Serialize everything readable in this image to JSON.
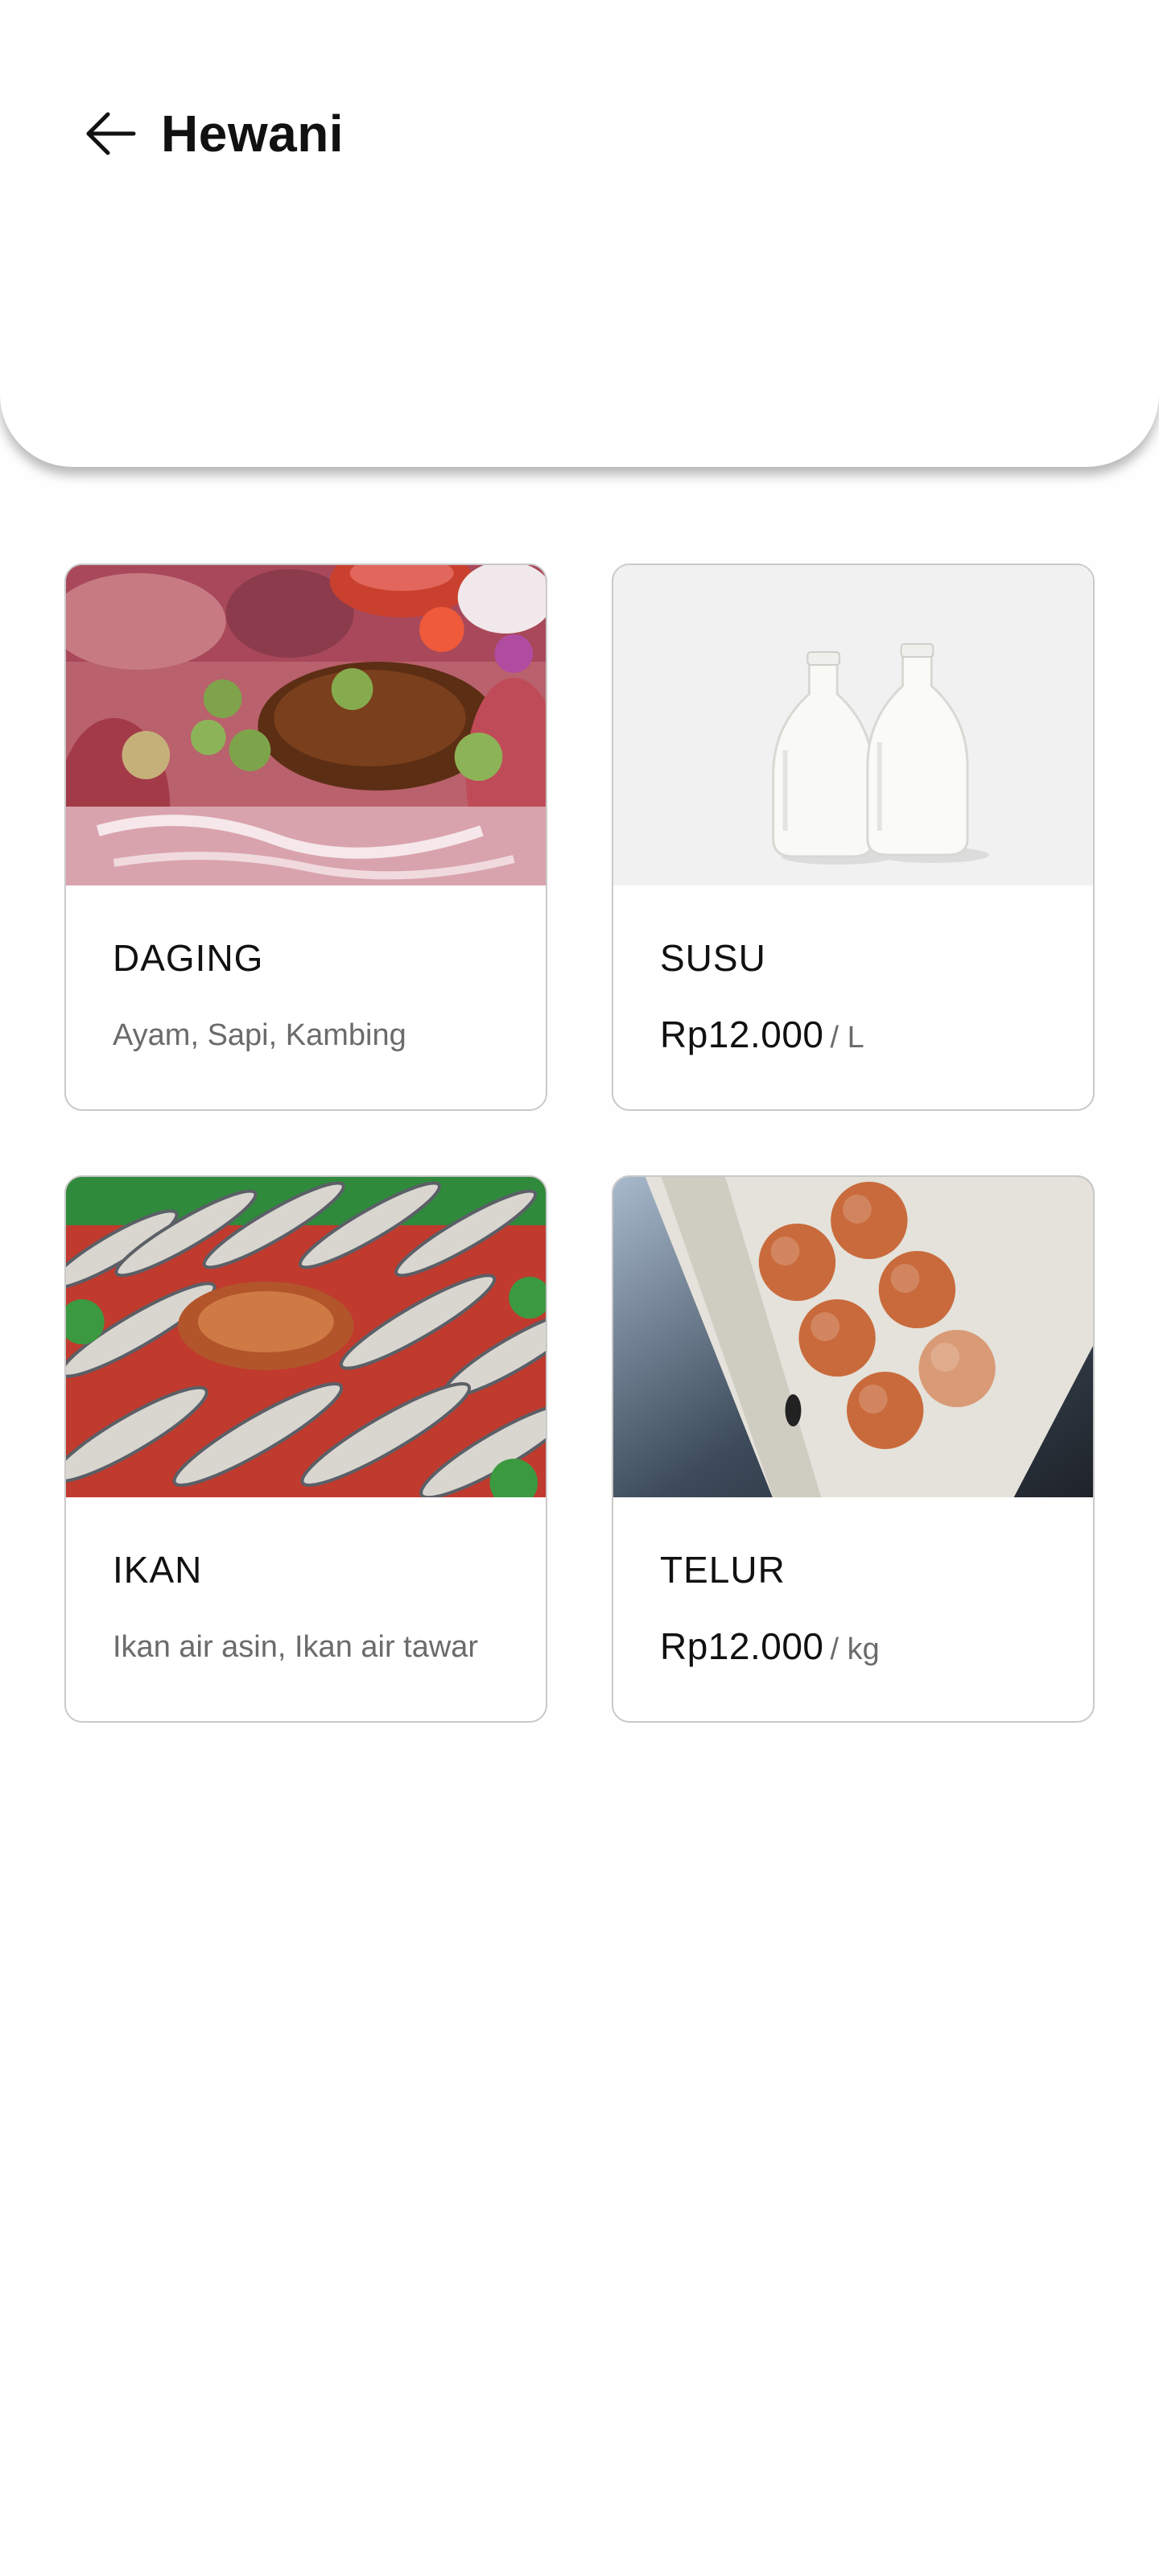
{
  "header": {
    "title": "Hewani",
    "back_icon": "arrow-left-icon"
  },
  "cards": [
    {
      "name": "DAGING",
      "subtitle": "Ayam, Sapi, Kambing",
      "image": "meat-platter-image"
    },
    {
      "name": "SUSU",
      "price": "Rp12.000",
      "unit": "/ L",
      "image": "milk-bottles-image"
    },
    {
      "name": "IKAN",
      "subtitle": "Ikan air asin, Ikan air tawar",
      "image": "fish-market-image"
    },
    {
      "name": "TELUR",
      "price": "Rp12.000",
      "unit": "/ kg",
      "image": "egg-carton-image"
    }
  ],
  "colors": {
    "card_border": "#c9c9c9",
    "subtitle_text": "#6b6b6b",
    "title_text": "#111111"
  }
}
